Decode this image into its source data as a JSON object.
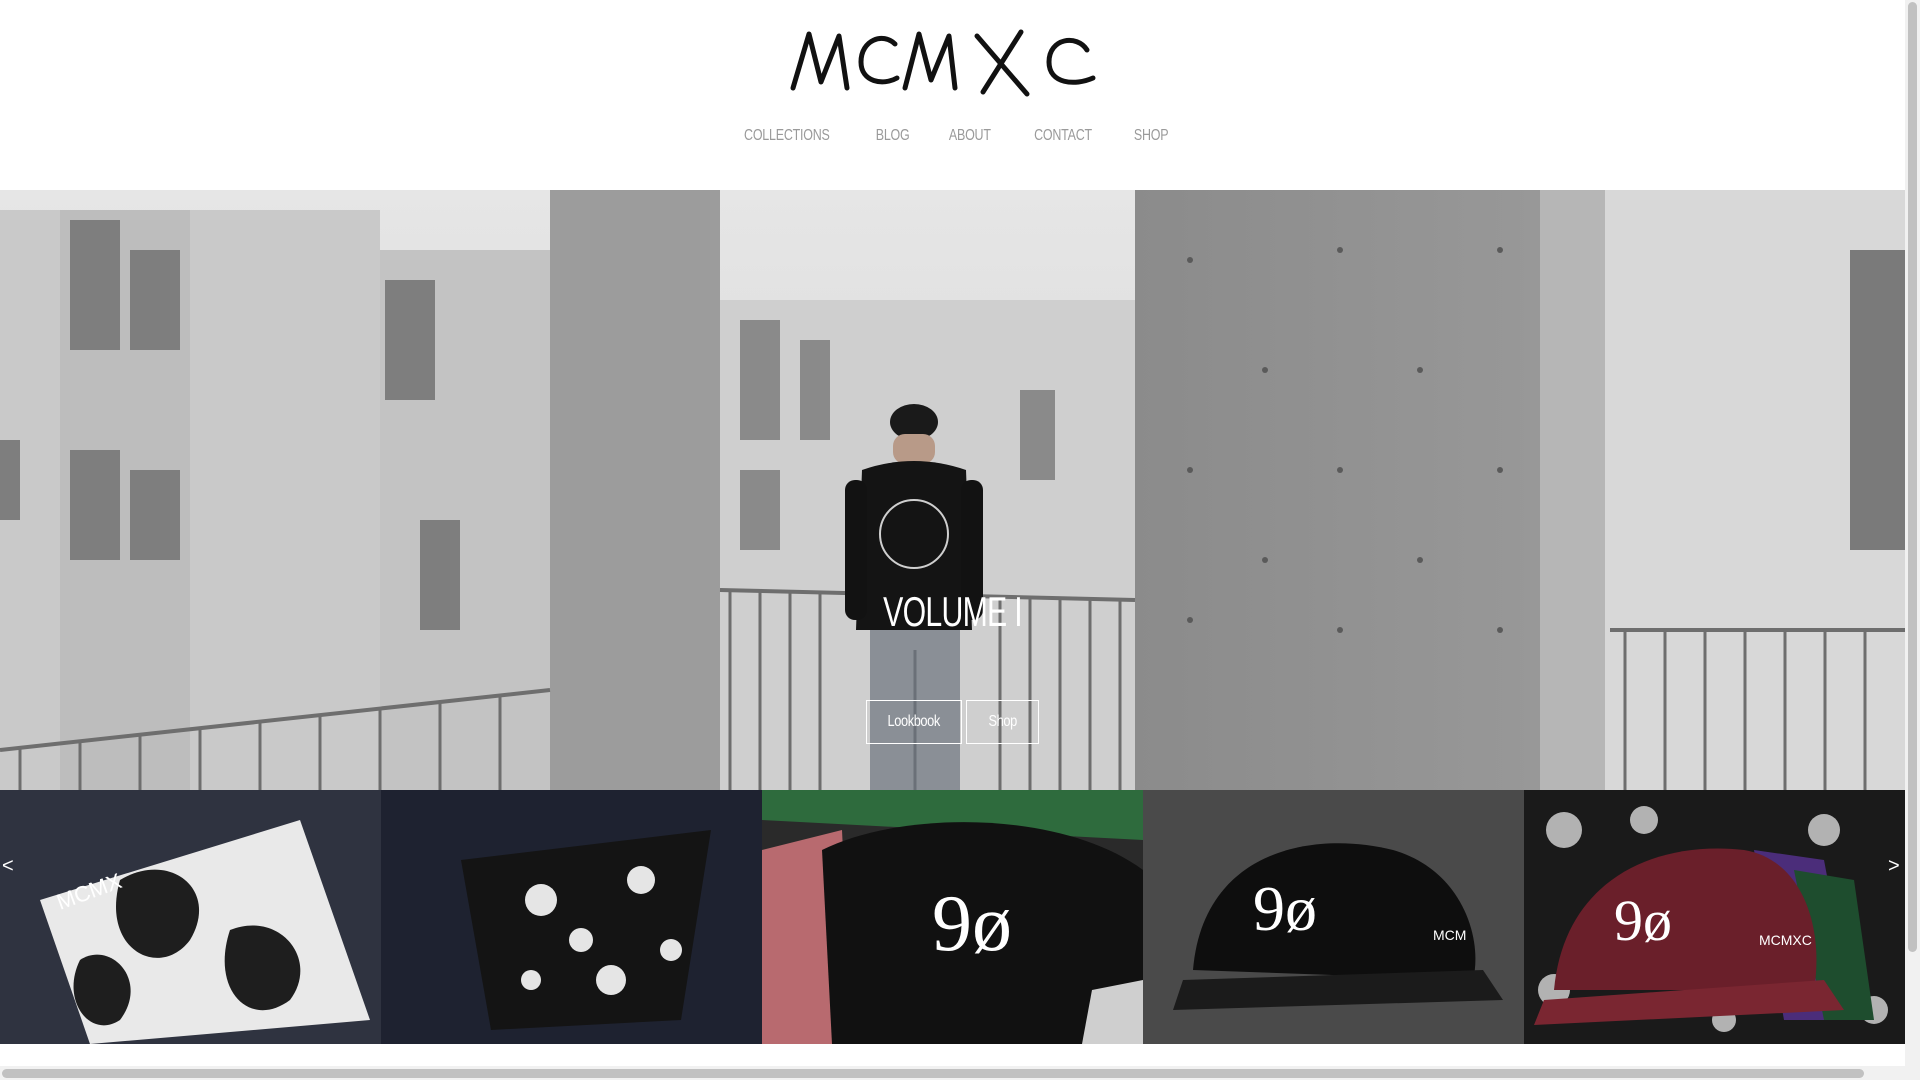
{
  "brand": {
    "logo_text": "MCMXC"
  },
  "nav": {
    "items": [
      {
        "label": "COLLECTIONS"
      },
      {
        "label": "BLOG"
      },
      {
        "label": "ABOUT"
      },
      {
        "label": "CONTACT"
      },
      {
        "label": "SHOP"
      }
    ]
  },
  "hero": {
    "title": "VOLUME I",
    "buttons": {
      "lookbook": "Lookbook",
      "shop": "Shop"
    },
    "slides": {
      "count": 3,
      "active": 1
    }
  },
  "carousel": {
    "prev": "<",
    "next": ">",
    "tiles": [
      {
        "name": "floral-pocket-tee-white"
      },
      {
        "name": "floral-pocket-tee-black"
      },
      {
        "name": "90-snapback-group"
      },
      {
        "name": "90-snapback-black"
      },
      {
        "name": "90-snapback-burgundy"
      }
    ]
  },
  "colors": {
    "nav_text": "#9a9a9a",
    "hero_text": "#ffffff"
  }
}
